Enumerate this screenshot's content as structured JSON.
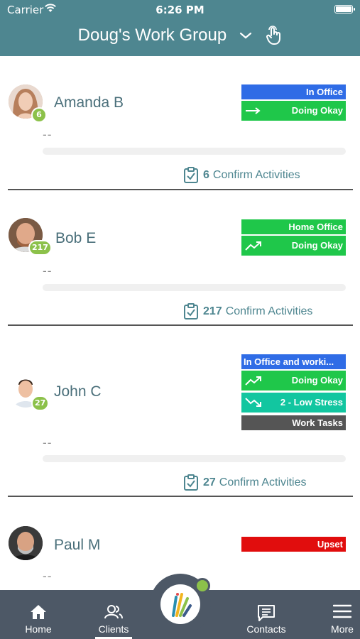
{
  "status": {
    "carrier": "Carrier",
    "time": "6:26 PM"
  },
  "header": {
    "title": "Doug's Work Group"
  },
  "clients": [
    {
      "name": "Amanda B",
      "count": "6",
      "note": "--",
      "confirm_count": "6",
      "confirm_label": "Confirm Activities",
      "tags": [
        {
          "label": "In Office",
          "color": "#2f6ce6",
          "icon": "arrow-right-icon"
        },
        {
          "label": "Doing Okay",
          "color": "#1fc74a",
          "icon": "arrow-right-icon"
        }
      ]
    },
    {
      "name": "Bob E",
      "count": "217",
      "note": "--",
      "confirm_count": "217",
      "confirm_label": "Confirm Activities",
      "tags": [
        {
          "label": "Home Office",
          "color": "#1fc74a"
        },
        {
          "label": "Doing Okay",
          "color": "#1fc74a",
          "icon": "trend-up-icon"
        }
      ]
    },
    {
      "name": "John C",
      "count": "27",
      "note": "--",
      "confirm_count": "27",
      "confirm_label": "Confirm Activities",
      "tags": [
        {
          "label": "In Office and worki...",
          "color": "#2f6ce6"
        },
        {
          "label": "Doing Okay",
          "color": "#1fc74a",
          "icon": "trend-up-icon"
        },
        {
          "label": "2 - Low Stress",
          "color": "#12c6a0",
          "icon": "trend-down-icon"
        },
        {
          "label": "Work Tasks",
          "color": "#555555"
        }
      ]
    },
    {
      "name": "Paul M",
      "note": "--",
      "tags": [
        {
          "label": "Upset",
          "color": "#e10d0d"
        }
      ]
    }
  ],
  "nav": {
    "home": "Home",
    "clients": "Clients",
    "contacts": "Contacts",
    "more": "More"
  },
  "colors": {
    "header": "#4e8690",
    "nav": "#4d5866",
    "accent": "#8cc14a"
  }
}
